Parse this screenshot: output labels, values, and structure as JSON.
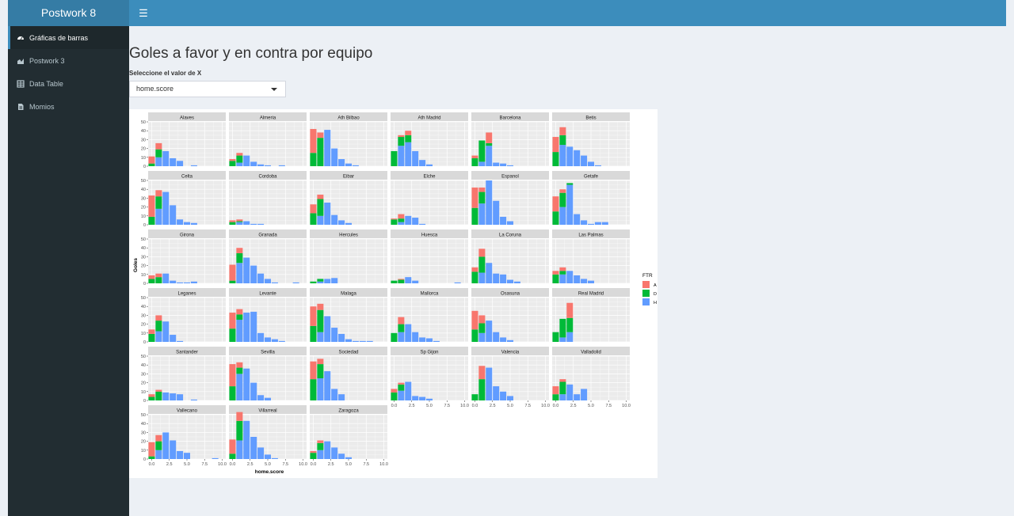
{
  "app": {
    "brand": "Postwork 8"
  },
  "sidebar": {
    "items": [
      {
        "label": "Gráficas de barras",
        "icon": "dashboard-icon",
        "active": true
      },
      {
        "label": "Postwork 3",
        "icon": "area-chart-icon",
        "active": false
      },
      {
        "label": "Data Table",
        "icon": "table-icon",
        "active": false
      },
      {
        "label": "Momios",
        "icon": "file-icon",
        "active": false
      }
    ]
  },
  "main": {
    "title": "Goles a favor y en contra por equipo",
    "select_label": "Seleccione el valor de X",
    "select_value": "home.score"
  },
  "colors": {
    "A": "#f8766d",
    "D": "#00ba38",
    "H": "#619cff",
    "header": "#3c8dbc",
    "sidebar": "#222d32"
  },
  "chart_data": {
    "type": "bar",
    "stacked": true,
    "xlabel": "home.score",
    "ylabel": "Goles",
    "ylim": [
      0,
      50
    ],
    "y_ticks": [
      "0",
      "10",
      "20",
      "30",
      "40",
      "50"
    ],
    "xlim": [
      -0.5,
      10.5
    ],
    "x_ticks": [
      "0.0",
      "2.5",
      "5.0",
      "7.5",
      "10.0"
    ],
    "x_tick_values": [
      0,
      2.5,
      5,
      7.5,
      10
    ],
    "legend": {
      "title": "FTR",
      "position": "right",
      "entries": [
        "A",
        "D",
        "H"
      ]
    },
    "grid": true,
    "stack_order": [
      "H",
      "D",
      "A"
    ],
    "panels": [
      {
        "team": "Alaves",
        "A": [
          8,
          7,
          0,
          0,
          0,
          0,
          0,
          0,
          0,
          0,
          0
        ],
        "D": [
          3,
          9,
          0,
          0,
          0,
          0,
          0,
          0,
          0,
          0,
          0
        ],
        "H": [
          0,
          10,
          17,
          9,
          6,
          0,
          1,
          0,
          0,
          0,
          0
        ]
      },
      {
        "team": "Almeria",
        "A": [
          2,
          3,
          0,
          0,
          0,
          0,
          0,
          0,
          0,
          0,
          0
        ],
        "D": [
          6,
          8,
          0,
          0,
          0,
          0,
          0,
          0,
          0,
          0,
          0
        ],
        "H": [
          0,
          4,
          12,
          5,
          2,
          1,
          0,
          1,
          0,
          0,
          0
        ]
      },
      {
        "team": "Ath Bilbao",
        "A": [
          27,
          6,
          0,
          0,
          0,
          0,
          0,
          0,
          0,
          0,
          0
        ],
        "D": [
          15,
          32,
          0,
          0,
          0,
          0,
          0,
          0,
          0,
          0,
          0
        ],
        "H": [
          0,
          0,
          41,
          20,
          8,
          3,
          1,
          0,
          0,
          0,
          0
        ]
      },
      {
        "team": "Ath Madrid",
        "A": [
          0,
          2,
          5,
          0,
          0,
          0,
          0,
          0,
          0,
          0,
          0
        ],
        "D": [
          17,
          10,
          8,
          0,
          0,
          0,
          0,
          0,
          0,
          0,
          0
        ],
        "H": [
          0,
          23,
          27,
          17,
          7,
          2,
          0,
          0,
          0,
          0,
          0
        ]
      },
      {
        "team": "Barcelona",
        "A": [
          3,
          0,
          12,
          0,
          0,
          0,
          0,
          0,
          0,
          0,
          0
        ],
        "D": [
          9,
          24,
          3,
          0,
          0,
          0,
          0,
          0,
          0,
          0,
          0
        ],
        "H": [
          0,
          5,
          23,
          4,
          3,
          1,
          0,
          0,
          0,
          0,
          0
        ]
      },
      {
        "team": "Betis",
        "A": [
          17,
          9,
          0,
          0,
          0,
          0,
          0,
          0,
          0,
          0,
          0
        ],
        "D": [
          16,
          11,
          0,
          0,
          0,
          0,
          0,
          0,
          0,
          0,
          0
        ],
        "H": [
          0,
          24,
          22,
          18,
          12,
          5,
          1,
          0,
          0,
          0,
          0
        ]
      },
      {
        "team": "Celta",
        "A": [
          24,
          7,
          0,
          0,
          0,
          0,
          0,
          0,
          0,
          0,
          0
        ],
        "D": [
          9,
          14,
          0,
          0,
          0,
          0,
          0,
          0,
          0,
          0,
          0
        ],
        "H": [
          0,
          18,
          37,
          22,
          6,
          3,
          2,
          0,
          0,
          0,
          0
        ]
      },
      {
        "team": "Cordoba",
        "A": [
          2,
          2,
          0,
          0,
          0,
          0,
          0,
          0,
          0,
          0,
          0
        ],
        "D": [
          3,
          1,
          0,
          0,
          0,
          0,
          0,
          0,
          0,
          0,
          0
        ],
        "H": [
          0,
          3,
          4,
          1,
          1,
          0,
          0,
          0,
          0,
          0,
          0
        ]
      },
      {
        "team": "Eibar",
        "A": [
          10,
          5,
          0,
          0,
          0,
          0,
          0,
          0,
          0,
          0,
          0
        ],
        "D": [
          13,
          19,
          0,
          0,
          0,
          0,
          0,
          0,
          0,
          0,
          0
        ],
        "H": [
          0,
          10,
          25,
          11,
          5,
          2,
          0,
          0,
          0,
          0,
          0
        ]
      },
      {
        "team": "Elche",
        "A": [
          1,
          5,
          0,
          0,
          0,
          0,
          0,
          0,
          0,
          0,
          0
        ],
        "D": [
          6,
          4,
          0,
          0,
          0,
          0,
          0,
          0,
          0,
          0,
          0
        ],
        "H": [
          0,
          3,
          10,
          8,
          1,
          0,
          0,
          0,
          0,
          0,
          0
        ]
      },
      {
        "team": "Espanol",
        "A": [
          23,
          5,
          0,
          0,
          0,
          0,
          0,
          0,
          0,
          0,
          0
        ],
        "D": [
          19,
          13,
          0,
          0,
          0,
          0,
          0,
          0,
          0,
          0,
          0
        ],
        "H": [
          0,
          24,
          50,
          27,
          9,
          4,
          0,
          0,
          0,
          0,
          0
        ]
      },
      {
        "team": "Getafe",
        "A": [
          17,
          4,
          0,
          0,
          0,
          0,
          0,
          0,
          0,
          0,
          0
        ],
        "D": [
          15,
          16,
          2,
          0,
          0,
          0,
          0,
          0,
          0,
          0,
          0
        ],
        "H": [
          0,
          20,
          45,
          12,
          5,
          1,
          3,
          3,
          0,
          0,
          0
        ]
      },
      {
        "team": "Girona",
        "A": [
          4,
          4,
          0,
          0,
          0,
          0,
          0,
          0,
          0,
          0,
          0
        ],
        "D": [
          5,
          7,
          0,
          0,
          0,
          0,
          0,
          0,
          0,
          0,
          0
        ],
        "H": [
          0,
          0,
          11,
          3,
          1,
          1,
          2,
          0,
          0,
          0,
          0
        ]
      },
      {
        "team": "Granada",
        "A": [
          18,
          6,
          0,
          0,
          0,
          0,
          0,
          0,
          0,
          0,
          0
        ],
        "D": [
          3,
          11,
          0,
          0,
          0,
          0,
          0,
          0,
          0,
          0,
          0
        ],
        "H": [
          0,
          23,
          29,
          20,
          11,
          5,
          1,
          0,
          0,
          1,
          0
        ]
      },
      {
        "team": "Hercules",
        "A": [
          0,
          0,
          0,
          0,
          0,
          0,
          0,
          0,
          0,
          0,
          0
        ],
        "D": [
          2,
          3,
          0,
          0,
          0,
          0,
          0,
          0,
          0,
          0,
          0
        ],
        "H": [
          0,
          2,
          5,
          6,
          0,
          0,
          0,
          0,
          0,
          0,
          0
        ]
      },
      {
        "team": "Huesca",
        "A": [
          0,
          1,
          0,
          0,
          0,
          0,
          0,
          0,
          0,
          0,
          0
        ],
        "D": [
          3,
          4,
          0,
          0,
          0,
          0,
          0,
          0,
          0,
          0,
          0
        ],
        "H": [
          0,
          0,
          7,
          3,
          0,
          0,
          0,
          0,
          0,
          1,
          0
        ]
      },
      {
        "team": "La Coruna",
        "A": [
          5,
          9,
          0,
          0,
          0,
          0,
          0,
          0,
          0,
          0,
          0
        ],
        "D": [
          13,
          18,
          0,
          0,
          0,
          0,
          0,
          0,
          0,
          0,
          0
        ],
        "H": [
          0,
          12,
          23,
          11,
          10,
          4,
          2,
          0,
          0,
          0,
          0
        ]
      },
      {
        "team": "Las Palmas",
        "A": [
          4,
          4,
          0,
          0,
          0,
          0,
          0,
          0,
          0,
          0,
          0
        ],
        "D": [
          10,
          4,
          0,
          0,
          0,
          0,
          0,
          0,
          0,
          0,
          0
        ],
        "H": [
          0,
          10,
          14,
          9,
          5,
          3,
          0,
          0,
          0,
          0,
          0
        ]
      },
      {
        "team": "Leganes",
        "A": [
          5,
          6,
          0,
          0,
          0,
          0,
          0,
          0,
          0,
          0,
          0
        ],
        "D": [
          9,
          12,
          0,
          0,
          0,
          0,
          0,
          0,
          0,
          0,
          0
        ],
        "H": [
          0,
          12,
          23,
          8,
          1,
          0,
          0,
          0,
          0,
          0,
          0
        ]
      },
      {
        "team": "Levante",
        "A": [
          18,
          6,
          0,
          0,
          0,
          0,
          0,
          0,
          0,
          0,
          0
        ],
        "D": [
          15,
          6,
          0,
          0,
          0,
          0,
          0,
          0,
          0,
          0,
          0
        ],
        "H": [
          0,
          25,
          33,
          34,
          10,
          5,
          3,
          1,
          0,
          0,
          0
        ]
      },
      {
        "team": "Malaga",
        "A": [
          22,
          7,
          0,
          0,
          0,
          0,
          0,
          0,
          0,
          0,
          0
        ],
        "D": [
          18,
          25,
          0,
          0,
          0,
          0,
          0,
          0,
          0,
          0,
          0
        ],
        "H": [
          0,
          11,
          29,
          16,
          9,
          3,
          1,
          1,
          1,
          0,
          0
        ]
      },
      {
        "team": "Mallorca",
        "A": [
          0,
          8,
          0,
          0,
          0,
          0,
          0,
          0,
          0,
          0,
          0
        ],
        "D": [
          10,
          9,
          0,
          0,
          0,
          0,
          0,
          0,
          0,
          0,
          0
        ],
        "H": [
          0,
          11,
          20,
          11,
          5,
          4,
          1,
          0,
          0,
          0,
          0
        ]
      },
      {
        "team": "Osasuna",
        "A": [
          21,
          9,
          0,
          0,
          0,
          0,
          0,
          0,
          0,
          0,
          0
        ],
        "D": [
          14,
          11,
          0,
          0,
          0,
          0,
          0,
          0,
          0,
          0,
          0
        ],
        "H": [
          0,
          10,
          24,
          11,
          5,
          2,
          0,
          0,
          0,
          0,
          0
        ]
      },
      {
        "team": "Real Madrid",
        "A": [
          0,
          0,
          17,
          0,
          0,
          0,
          0,
          0,
          0,
          0,
          0
        ],
        "D": [
          11,
          21,
          16,
          0,
          0,
          0,
          0,
          0,
          0,
          0,
          0
        ],
        "H": [
          0,
          5,
          11,
          0,
          0,
          0,
          0,
          0,
          0,
          0,
          0
        ]
      },
      {
        "team": "Santander",
        "A": [
          3,
          2,
          0,
          0,
          0,
          0,
          0,
          0,
          0,
          0,
          0
        ],
        "D": [
          4,
          10,
          0,
          0,
          0,
          0,
          0,
          0,
          0,
          0,
          0
        ],
        "H": [
          0,
          0,
          9,
          8,
          7,
          0,
          1,
          0,
          0,
          0,
          0
        ]
      },
      {
        "team": "Sevilla",
        "A": [
          25,
          6,
          0,
          0,
          0,
          0,
          0,
          0,
          0,
          0,
          0
        ],
        "D": [
          16,
          7,
          0,
          0,
          0,
          0,
          0,
          0,
          0,
          0,
          0
        ],
        "H": [
          0,
          30,
          36,
          20,
          6,
          3,
          0,
          0,
          0,
          0,
          0
        ]
      },
      {
        "team": "Sociedad",
        "A": [
          20,
          6,
          0,
          0,
          0,
          0,
          0,
          0,
          0,
          0,
          0
        ],
        "D": [
          24,
          16,
          0,
          0,
          0,
          0,
          0,
          0,
          0,
          0,
          0
        ],
        "H": [
          0,
          25,
          33,
          13,
          7,
          0,
          0,
          0,
          0,
          0,
          0
        ]
      },
      {
        "team": "Sp Gijon",
        "A": [
          4,
          2,
          0,
          0,
          0,
          0,
          0,
          0,
          0,
          0,
          0
        ],
        "D": [
          9,
          7,
          0,
          0,
          0,
          0,
          0,
          0,
          0,
          0,
          0
        ],
        "H": [
          0,
          11,
          21,
          5,
          4,
          2,
          0,
          0,
          0,
          0,
          0
        ]
      },
      {
        "team": "Valencia",
        "A": [
          0,
          15,
          0,
          0,
          0,
          0,
          0,
          0,
          0,
          0,
          0
        ],
        "D": [
          7,
          24,
          0,
          0,
          0,
          0,
          0,
          0,
          0,
          0,
          0
        ],
        "H": [
          0,
          0,
          37,
          16,
          10,
          5,
          0,
          0,
          0,
          0,
          0
        ]
      },
      {
        "team": "Valladolid",
        "A": [
          9,
          3,
          0,
          0,
          0,
          0,
          0,
          0,
          0,
          0,
          0
        ],
        "D": [
          7,
          14,
          0,
          0,
          0,
          0,
          0,
          0,
          0,
          0,
          0
        ],
        "H": [
          0,
          7,
          18,
          7,
          13,
          0,
          0,
          0,
          0,
          0,
          0
        ]
      },
      {
        "team": "Vallecano",
        "A": [
          16,
          7,
          0,
          0,
          0,
          0,
          0,
          0,
          0,
          0,
          0
        ],
        "D": [
          3,
          10,
          0,
          0,
          0,
          0,
          0,
          0,
          0,
          0,
          0
        ],
        "H": [
          0,
          10,
          30,
          21,
          9,
          7,
          0,
          0,
          0,
          1,
          0
        ]
      },
      {
        "team": "Villarreal",
        "A": [
          16,
          10,
          0,
          0,
          0,
          0,
          0,
          0,
          0,
          0,
          0
        ],
        "D": [
          6,
          22,
          0,
          0,
          0,
          0,
          0,
          0,
          0,
          0,
          0
        ],
        "H": [
          0,
          21,
          43,
          25,
          13,
          5,
          1,
          0,
          0,
          0,
          0
        ]
      },
      {
        "team": "Zaragoza",
        "A": [
          2,
          3,
          0,
          0,
          0,
          0,
          0,
          0,
          0,
          0,
          0
        ],
        "D": [
          7,
          8,
          0,
          0,
          0,
          0,
          0,
          0,
          0,
          0,
          0
        ],
        "H": [
          0,
          10,
          20,
          13,
          6,
          2,
          0,
          0,
          0,
          0,
          0
        ]
      }
    ]
  }
}
